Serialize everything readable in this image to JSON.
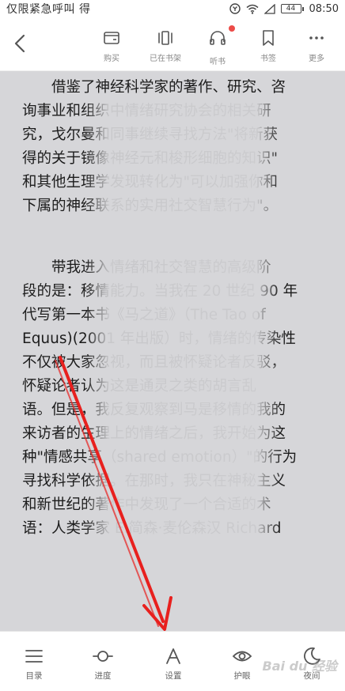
{
  "status_bar": {
    "left_text": "仅限紧急呼叫 得",
    "battery": "44",
    "time": "08:50"
  },
  "toolbar": {
    "back_icon": "chevron-left-icon",
    "items": [
      {
        "label": "购买",
        "icon": "wallet-icon"
      },
      {
        "label": "已在书架",
        "icon": "bookshelf-icon"
      },
      {
        "label": "听书",
        "icon": "headphones-icon",
        "badge": true
      },
      {
        "label": "书签",
        "icon": "bookmark-icon"
      },
      {
        "label": "更多",
        "icon": "more-icon"
      }
    ]
  },
  "content": {
    "paragraphs": [
      {
        "lines": [
          "　　借鉴了神经科学家的著作、研究、咨",
          "询事业和组织中情绪研究协会的相关研",
          "究，戈尔曼和同事继续寻找方法\"将新获",
          "得的关于镜像神经元和梭形细胞的知识\"",
          "和其他生理学发现转化为\"可以加强你和",
          "下属的神经联系的实用社交智慧行为\"。"
        ]
      },
      {
        "lines": [
          "　　带我进入情绪和社交智慧的高级阶",
          "段的是：移情能力。当我在 20 世纪 90 年",
          "代写第一本书《马之道》（The Tao of",
          "Equus)(2001 年出版）时，情绪的传染性",
          "不仅被大家忽视，而且被怀疑论者反驳，",
          "怀疑论者认为这是通灵之类的胡言乱",
          "语。但是，我反复观察到马是移情的我的",
          "来访者的生理上的情绪之后，我开始为这",
          "种\"情感共享（shared emotion）\"的行为",
          "寻找科学依据。在那时，我只在神秘主义",
          "和新世纪的著作中发现了一个合适的术",
          "语：人类学家 E.简森·麦伦森汉 Richard"
        ]
      }
    ]
  },
  "bottom_nav": {
    "items": [
      {
        "label": "目录",
        "icon": "menu-icon"
      },
      {
        "label": "进度",
        "icon": "progress-icon"
      },
      {
        "label": "设置",
        "icon": "font-settings-icon"
      },
      {
        "label": "护眼",
        "icon": "eye-icon"
      },
      {
        "label": "夜间",
        "icon": "moon-icon"
      }
    ],
    "watermark": "Bai du 经验"
  },
  "colors": {
    "reading_bg": "#d6d6d9",
    "badge": "#ec4c48",
    "arrow": "#e8201e"
  }
}
